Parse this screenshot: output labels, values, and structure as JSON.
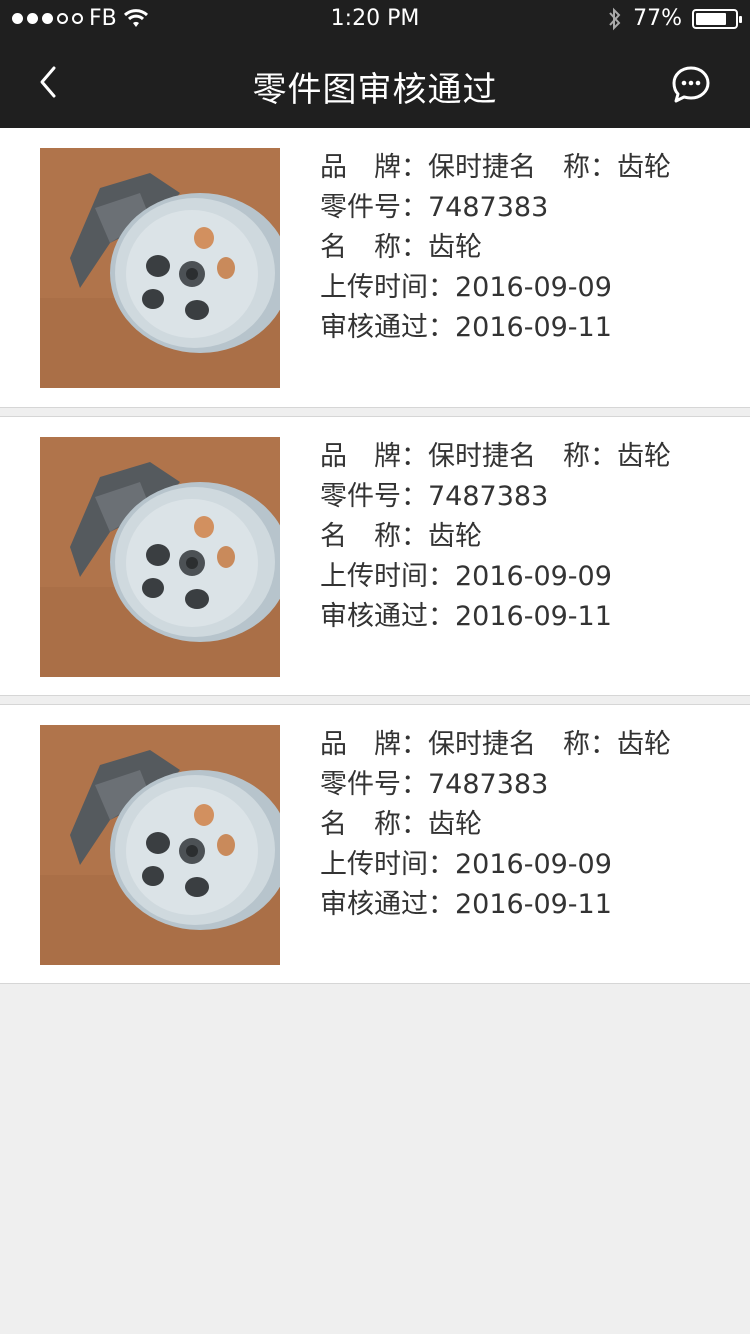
{
  "status_bar": {
    "carrier": "FB",
    "time": "1:20 PM",
    "battery": "77%"
  },
  "navbar": {
    "title": "零件图审核通过",
    "back_icon": "chevron-left-icon",
    "chat_icon": "chat-bubble-icon"
  },
  "items": [
    {
      "brand_label": "品　牌：",
      "brand_value": "保时捷",
      "name_inline_label": "名　称：",
      "name_inline_value": "齿轮",
      "part_no_label": "零件号：",
      "part_no": "7487383",
      "name_label": "名　称：",
      "name_value": "齿轮",
      "upload_label": "上传时间：",
      "upload_date": "2016-09-09",
      "approved_label": "审核通过：",
      "approved_date": "2016-09-11"
    },
    {
      "brand_label": "品　牌：",
      "brand_value": "保时捷",
      "name_inline_label": "名　称：",
      "name_inline_value": "齿轮",
      "part_no_label": "零件号：",
      "part_no": "7487383",
      "name_label": "名　称：",
      "name_value": "齿轮",
      "upload_label": "上传时间：",
      "upload_date": "2016-09-09",
      "approved_label": "审核通过：",
      "approved_date": "2016-09-11"
    },
    {
      "brand_label": "品　牌：",
      "brand_value": "保时捷",
      "name_inline_label": "名　称：",
      "name_inline_value": "齿轮",
      "part_no_label": "零件号：",
      "part_no": "7487383",
      "name_label": "名　称：",
      "name_value": "齿轮",
      "upload_label": "上传时间：",
      "upload_date": "2016-09-09",
      "approved_label": "审核通过：",
      "approved_date": "2016-09-11"
    }
  ],
  "colors": {
    "header_bg": "#1f1f1f",
    "page_bg": "#efefef",
    "card_bg": "#ffffff",
    "text": "#333333"
  }
}
